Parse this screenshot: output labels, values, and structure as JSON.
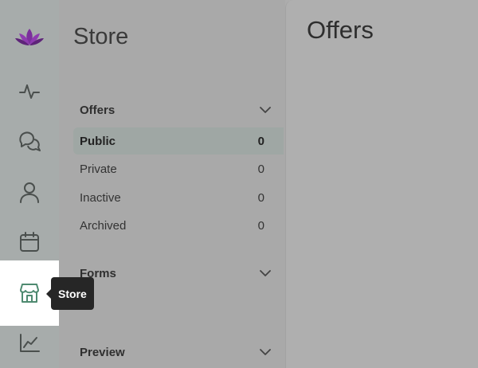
{
  "rail": {
    "items": [
      {
        "icon": "lotus-logo-icon"
      },
      {
        "icon": "activity-icon"
      },
      {
        "icon": "chat-bubbles-icon"
      },
      {
        "icon": "user-icon"
      },
      {
        "icon": "calendar-icon"
      },
      {
        "icon": "store-icon"
      },
      {
        "icon": "line-chart-icon"
      }
    ],
    "tooltip": "Store"
  },
  "store_panel": {
    "title": "Store",
    "sections": [
      {
        "label": "Offers",
        "items": [
          {
            "label": "Public",
            "count": "0"
          },
          {
            "label": "Private",
            "count": "0"
          },
          {
            "label": "Inactive",
            "count": "0"
          },
          {
            "label": "Archived",
            "count": "0"
          }
        ]
      },
      {
        "label": "Forms"
      },
      {
        "label": "Preview"
      }
    ]
  },
  "content": {
    "title": "Offers"
  },
  "colors": {
    "accent": "#6b2a8f",
    "active_icon": "#4e8a70",
    "tooltip_bg": "#262626"
  }
}
